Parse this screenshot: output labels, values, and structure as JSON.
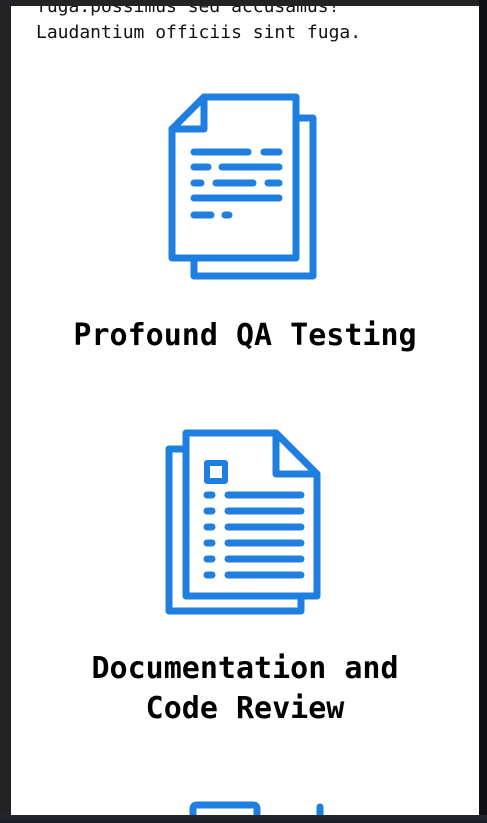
{
  "intro": {
    "line1": "fuga.possimus sed accusamus!",
    "line2": "Laudantium officiis sint fuga."
  },
  "features": [
    {
      "icon": "documents-icon",
      "title": "Profound QA Testing"
    },
    {
      "icon": "document-checklist-icon",
      "title": "Documentation and Code Review"
    }
  ],
  "next_feature": {
    "icon": "partial-icon"
  },
  "colors": {
    "accent": "#1e7fe0",
    "background": "#ffffff",
    "text": "#000000"
  }
}
